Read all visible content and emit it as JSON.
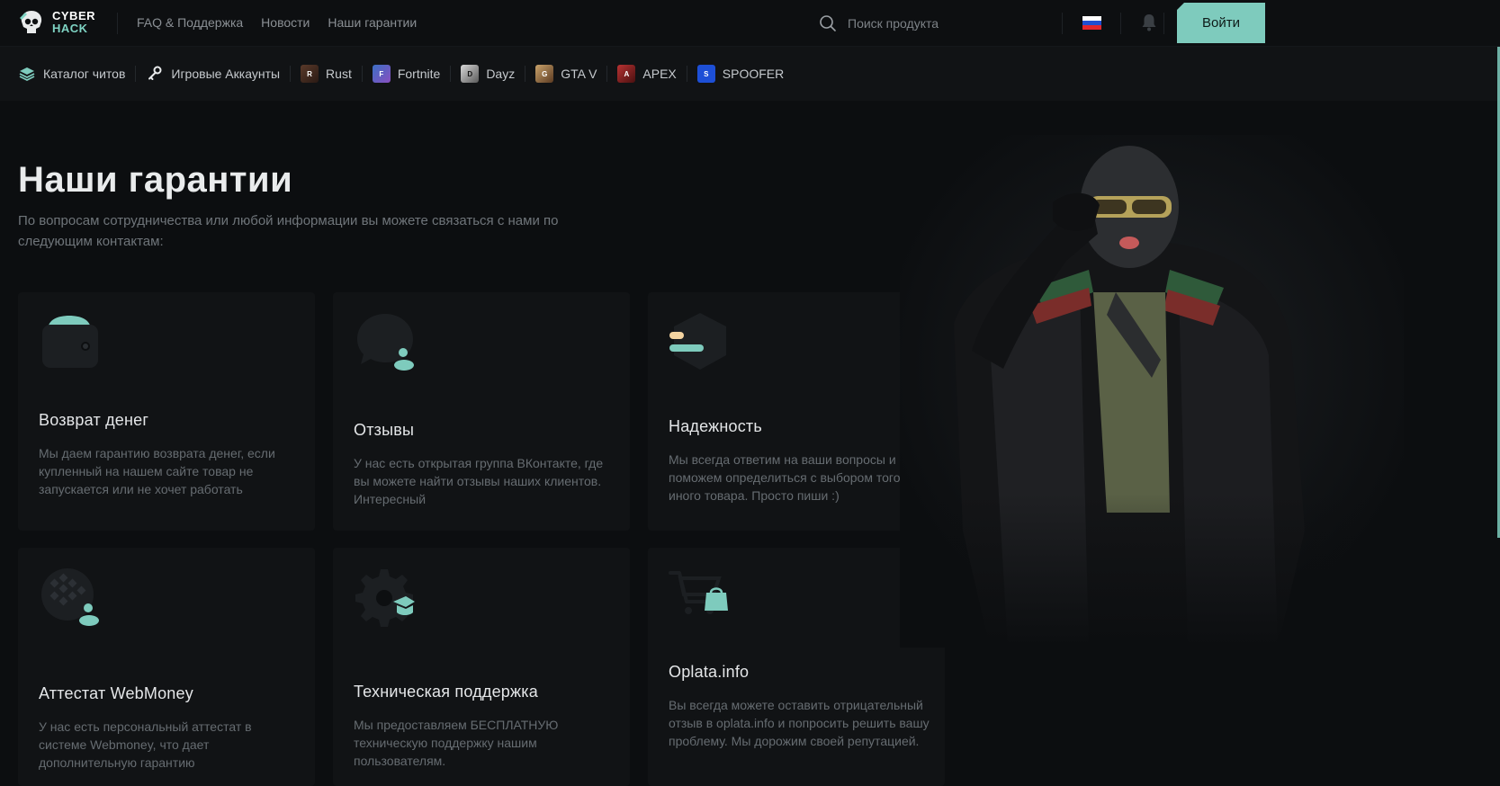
{
  "logo": {
    "line1": "CYBER",
    "line2": "HACK"
  },
  "top_nav": [
    {
      "label": "FAQ & Поддержка"
    },
    {
      "label": "Новости"
    },
    {
      "label": "Наши гарантии"
    }
  ],
  "search": {
    "placeholder": "Поиск продукта",
    "icon": "search-icon"
  },
  "language": {
    "flag_colors": [
      "#ffffff",
      "#1f4fd1",
      "#e2262c"
    ]
  },
  "login": {
    "label": "Войти"
  },
  "categories": [
    {
      "label": "Каталог читов",
      "icon": "layers-icon"
    },
    {
      "label": "Игровые Аккаунты",
      "icon": "key-icon"
    },
    {
      "label": "Rust",
      "icon": "rust-game-icon"
    },
    {
      "label": "Fortnite",
      "icon": "fortnite-game-icon"
    },
    {
      "label": "Dayz",
      "icon": "dayz-game-icon"
    },
    {
      "label": "GTA V",
      "icon": "gta-game-icon"
    },
    {
      "label": "APEX",
      "icon": "apex-game-icon"
    },
    {
      "label": "SPOOFER",
      "icon": "spoofer-icon"
    }
  ],
  "hero": {
    "title": "Наши гарантии",
    "subtitle": "По вопросам сотрудничества или любой информации вы можете связаться с нами по следующим контактам:"
  },
  "cards": [
    {
      "title": "Возврат денег",
      "text": "Мы даем гарантию возврата денег, если купленный на нашем сайте товар не запускается или не хочет работать",
      "icon": "wallet-icon"
    },
    {
      "title": "Отзывы",
      "text": "У нас есть открытая группа ВКонтакте, где вы можете найти отзывы наших клиентов. Интересный",
      "icon": "chat-bubble-icon"
    },
    {
      "title": "Надежность",
      "text": "Мы всегда ответим на ваши вопросы и поможем определиться с выбором того или иного товара. Просто пиши :)",
      "icon": "hexagon-shield-icon"
    },
    {
      "title": "Аттестат WebMoney",
      "text": "У нас есть персональный аттестат в системе Webmoney, что дает дополнительную гарантию",
      "icon": "webmoney-globe-icon"
    },
    {
      "title": "Техническая поддержка",
      "text": "Мы предоставляем БЕСПЛАТНУЮ техническую поддержку нашим пользователям.",
      "icon": "gear-support-icon"
    },
    {
      "title": "Oplata.info",
      "text": "Вы всегда можете оставить отрицательный отзыв в oplata.info и попросить решить вашу проблему. Мы дорожим своей репутацией.",
      "icon": "cart-bag-icon"
    }
  ],
  "colors": {
    "accent": "#7ecbbd",
    "background": "#0c0e10",
    "card": "#111315"
  }
}
